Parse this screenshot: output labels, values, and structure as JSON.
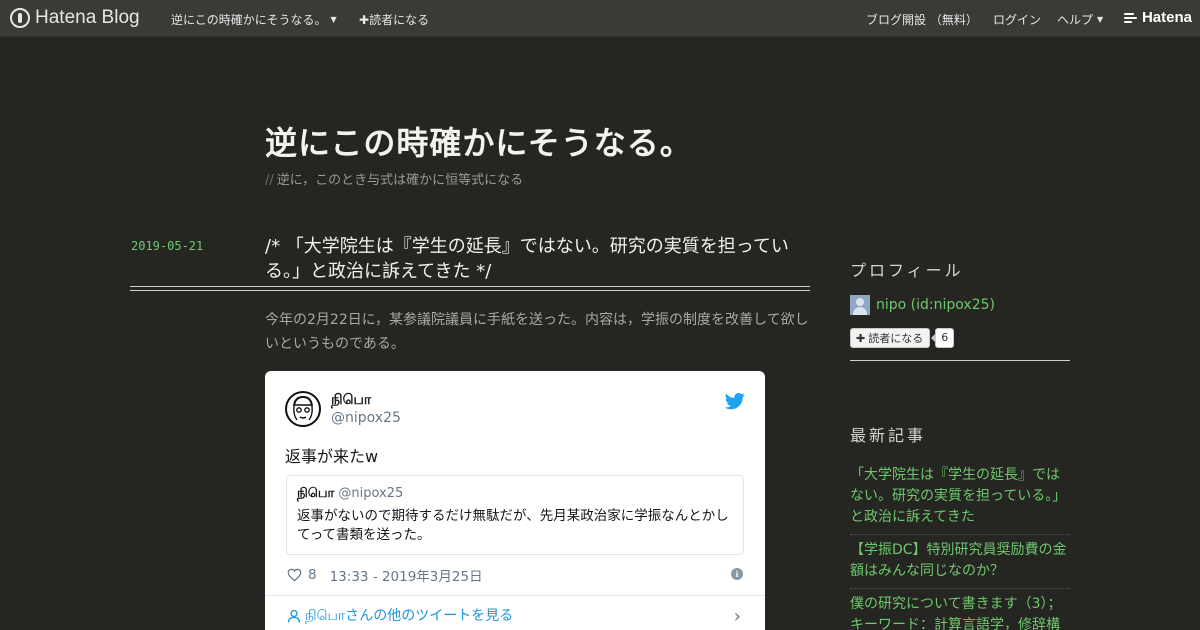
{
  "topbar": {
    "logo": "Hatena Blog",
    "blog_menu": "逆にこの時確かにそうなる。",
    "subscribe": "読者になる",
    "open_blog": "ブログ開設 （無料）",
    "login": "ログイン",
    "help": "ヘルプ",
    "hatena": "Hatena"
  },
  "header": {
    "title": "逆にこの時確かにそうなる。",
    "description": "逆に，このとき与式は確かに恒等式になる"
  },
  "entry": {
    "date": "2019-05-21",
    "title": "/* 「大学院生は『学生の延長』ではない。研究の実質を担っている。」と政治に訴えてきた */",
    "body": "今年の2月22日に，某参議院議員に手紙を送った。内容は，学振の制度を改善して欲しいというものである。"
  },
  "tweet": {
    "name": "நிபொ",
    "handle": "@nipox25",
    "text": "返事が来たw",
    "quote": {
      "name": "நிபொ",
      "handle": "@nipox25",
      "text": "返事がないので期待するだけ無駄だが、先月某政治家に学振なんとかしてって書類を送った。"
    },
    "likes": "8",
    "timestamp": "13:33 - 2019年3月25日",
    "more_link": "நிபொさんの他のツイートを見る"
  },
  "sidebar": {
    "profile_heading": "プロフィール",
    "profile_name": "nipo (id:nipox25)",
    "subscribe_label": "読者になる",
    "subscriber_count": "6",
    "recent_heading": "最新記事",
    "recent": [
      "「大学院生は『学生の延長』ではない。研究の実質を担っている。」と政治に訴えてきた",
      "【学振DC】特別研究員奨励費の金額はみんな同じなのか？",
      "僕の研究について書きます（3）；キーワード：計算言語学，修辞構"
    ]
  },
  "colors": {
    "background": "#252521",
    "topbar": "#3a3a37",
    "link_green": "#6ec86e",
    "twitter_blue": "#1da1f2"
  }
}
